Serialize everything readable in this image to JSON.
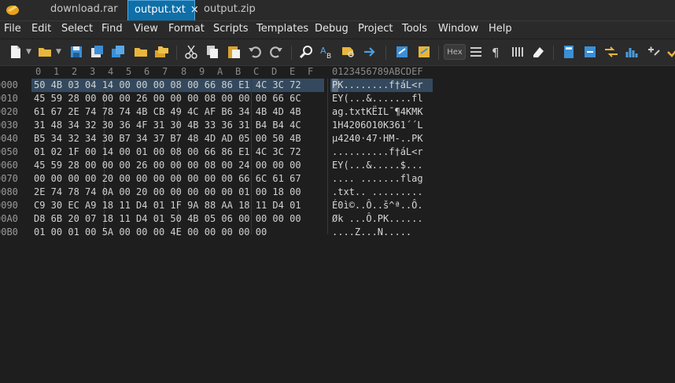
{
  "tabs": [
    {
      "label": "download.rar",
      "active": false
    },
    {
      "label": "output.txt",
      "active": true,
      "close": "×"
    },
    {
      "label": "output.zip",
      "active": false
    }
  ],
  "menu": [
    "File",
    "Edit",
    "Select",
    "Find",
    "View",
    "Format",
    "Scripts",
    "Templates",
    "Debug",
    "Project",
    "Tools",
    "Window",
    "Help"
  ],
  "toolbar": {
    "hex_label": "Hex",
    "icons": [
      "new-file",
      "open-folder",
      "save",
      "save-as",
      "save-all",
      "open-folder",
      "open-multiple",
      "cut",
      "copy",
      "paste",
      "undo",
      "redo",
      "find",
      "replace",
      "find-in-files",
      "goto",
      "compare",
      "tag",
      "hex-toggle",
      "line-numbers",
      "show-whitespace",
      "columns",
      "clear",
      "calculator",
      "convert",
      "swap",
      "histogram",
      "math"
    ]
  },
  "hex_header": {
    "columns": [
      "0",
      "1",
      "2",
      "3",
      "4",
      "5",
      "6",
      "7",
      "8",
      "9",
      "A",
      "B",
      "C",
      "D",
      "E",
      "F"
    ],
    "ascii_header": "0123456789ABCDEF"
  },
  "rows": [
    {
      "addr": "0000",
      "hex": "50 4B 03 04 14 00 00 00 08 00 66 86 E1 4C 3C 72",
      "ascii": "PK........f†áL<r"
    },
    {
      "addr": "0010",
      "hex": "45 59 28 00 00 00 26 00 00 00 08 00 00 00 66 6C",
      "ascii": "EY(...&.......fl"
    },
    {
      "addr": "0020",
      "hex": "61 67 2E 74 78 74 4B CB 49 4C AF B6 34 4B 4D 4B",
      "ascii": "ag.txtKËIL¯¶4KMK"
    },
    {
      "addr": "0030",
      "hex": "31 48 34 32 30 36 4F 31 30 4B 33 36 31 B4 B4 4C",
      "ascii": "1H4206O10K361´´L"
    },
    {
      "addr": "0040",
      "hex": "B5 34 32 34 30 B7 34 37 B7 48 4D AD 05 00 50 4B",
      "ascii": "µ4240·47·HM-..PK"
    },
    {
      "addr": "0050",
      "hex": "01 02 1F 00 14 00 01 00 08 00 66 86 E1 4C 3C 72",
      "ascii": "..........f†áL<r"
    },
    {
      "addr": "0060",
      "hex": "45 59 28 00 00 00 26 00 00 00 08 00 24 00 00 00",
      "ascii": "EY(...&.....$..."
    },
    {
      "addr": "0070",
      "hex": "00 00 00 00 20 00 00 00 00 00 00 00 66 6C 61 67",
      "ascii": ".... .......flag"
    },
    {
      "addr": "0080",
      "hex": "2E 74 78 74 0A 00 20 00 00 00 00 00 01 00 18 00",
      "ascii": ".txt.. ........."
    },
    {
      "addr": "0090",
      "hex": "C9 30 EC A9 18 11 D4 01 1F 9A 88 AA 18 11 D4 01",
      "ascii": "É0ì©..Ô..š^ª..Ô."
    },
    {
      "addr": "00A0",
      "hex": "D8 6B 20 07 18 11 D4 01 50 4B 05 06 00 00 00 00",
      "ascii": "Øk ...Ô.PK......"
    },
    {
      "addr": "00B0",
      "hex": "01 00 01 00 5A 00 00 00 4E 00 00 00 00 00",
      "ascii": "....Z...N....."
    }
  ]
}
